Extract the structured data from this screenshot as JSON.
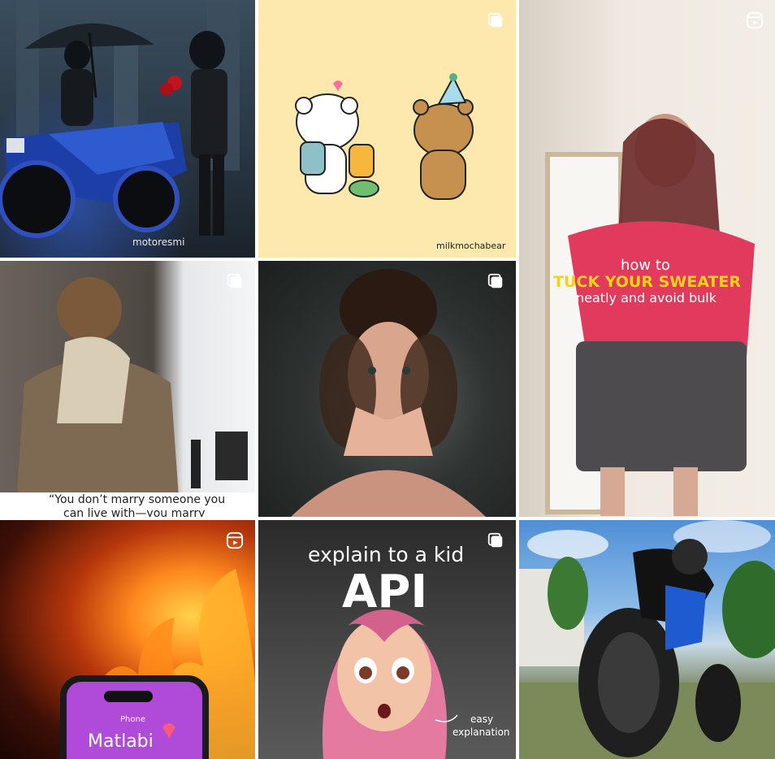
{
  "grid": {
    "posts": [
      {
        "id": "post-1",
        "caption_overlay": "motoresmi",
        "badge": null
      },
      {
        "id": "post-2",
        "caption_overlay": "milkmochabear",
        "badge": "carousel-icon"
      },
      {
        "id": "post-3",
        "caption_lines": [
          "how to",
          "TUCK YOUR SWEATER",
          "neatly and avoid bulk"
        ],
        "badge": "reel-icon"
      },
      {
        "id": "post-4",
        "caption_lines": [
          "“You don’t marry someone you",
          "can live with—you marry"
        ],
        "badge": "carousel-icon"
      },
      {
        "id": "post-5",
        "badge": "carousel-icon"
      },
      {
        "id": "post-7",
        "phone_label": "Phone",
        "phone_name": "Matlabi",
        "badge": "reel-icon"
      },
      {
        "id": "post-8",
        "caption_lines": [
          "explain to a kid",
          "API",
          "easy",
          "explanation"
        ],
        "badge": "carousel-icon"
      },
      {
        "id": "post-9",
        "badge": null
      }
    ]
  },
  "colors": {
    "sweater_highlight": "#f5d21a",
    "bear_heart": "#ff6f9a"
  }
}
